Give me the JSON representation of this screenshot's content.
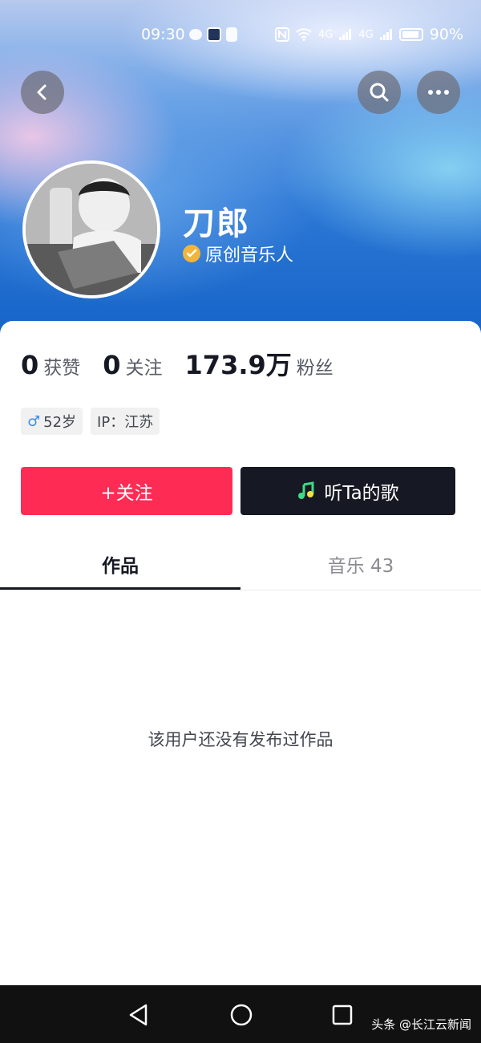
{
  "status_bar": {
    "time": "09:30",
    "network_a": "4G",
    "network_b": "4G",
    "battery": "90%",
    "battery_level": 0.9
  },
  "profile": {
    "name": "刀郎",
    "verify_label": "原创音乐人"
  },
  "stats": [
    {
      "value": "0",
      "label": "获赞"
    },
    {
      "value": "0",
      "label": "关注"
    },
    {
      "value": "173.9万",
      "label": "粉丝"
    }
  ],
  "tags": {
    "gender_symbol": "♂",
    "age": "52岁",
    "ip": "IP：江苏"
  },
  "actions": {
    "follow": "+关注",
    "listen": "听Ta的歌"
  },
  "tabs": [
    {
      "label": "作品",
      "active": true
    },
    {
      "label": "音乐 43",
      "active": false
    }
  ],
  "empty_message": "该用户还没有发布过作品",
  "watermark": "头条 @长江云新闻",
  "colors": {
    "follow": "#fe2c55",
    "dark_button": "#161823",
    "verify": "#f3b43a",
    "music_icon": "#3ddc84"
  },
  "icons": {
    "back": "chevron-left-icon",
    "search": "search-icon",
    "more": "more-dots-icon",
    "verify": "check-badge-icon",
    "music": "music-note-icon"
  }
}
